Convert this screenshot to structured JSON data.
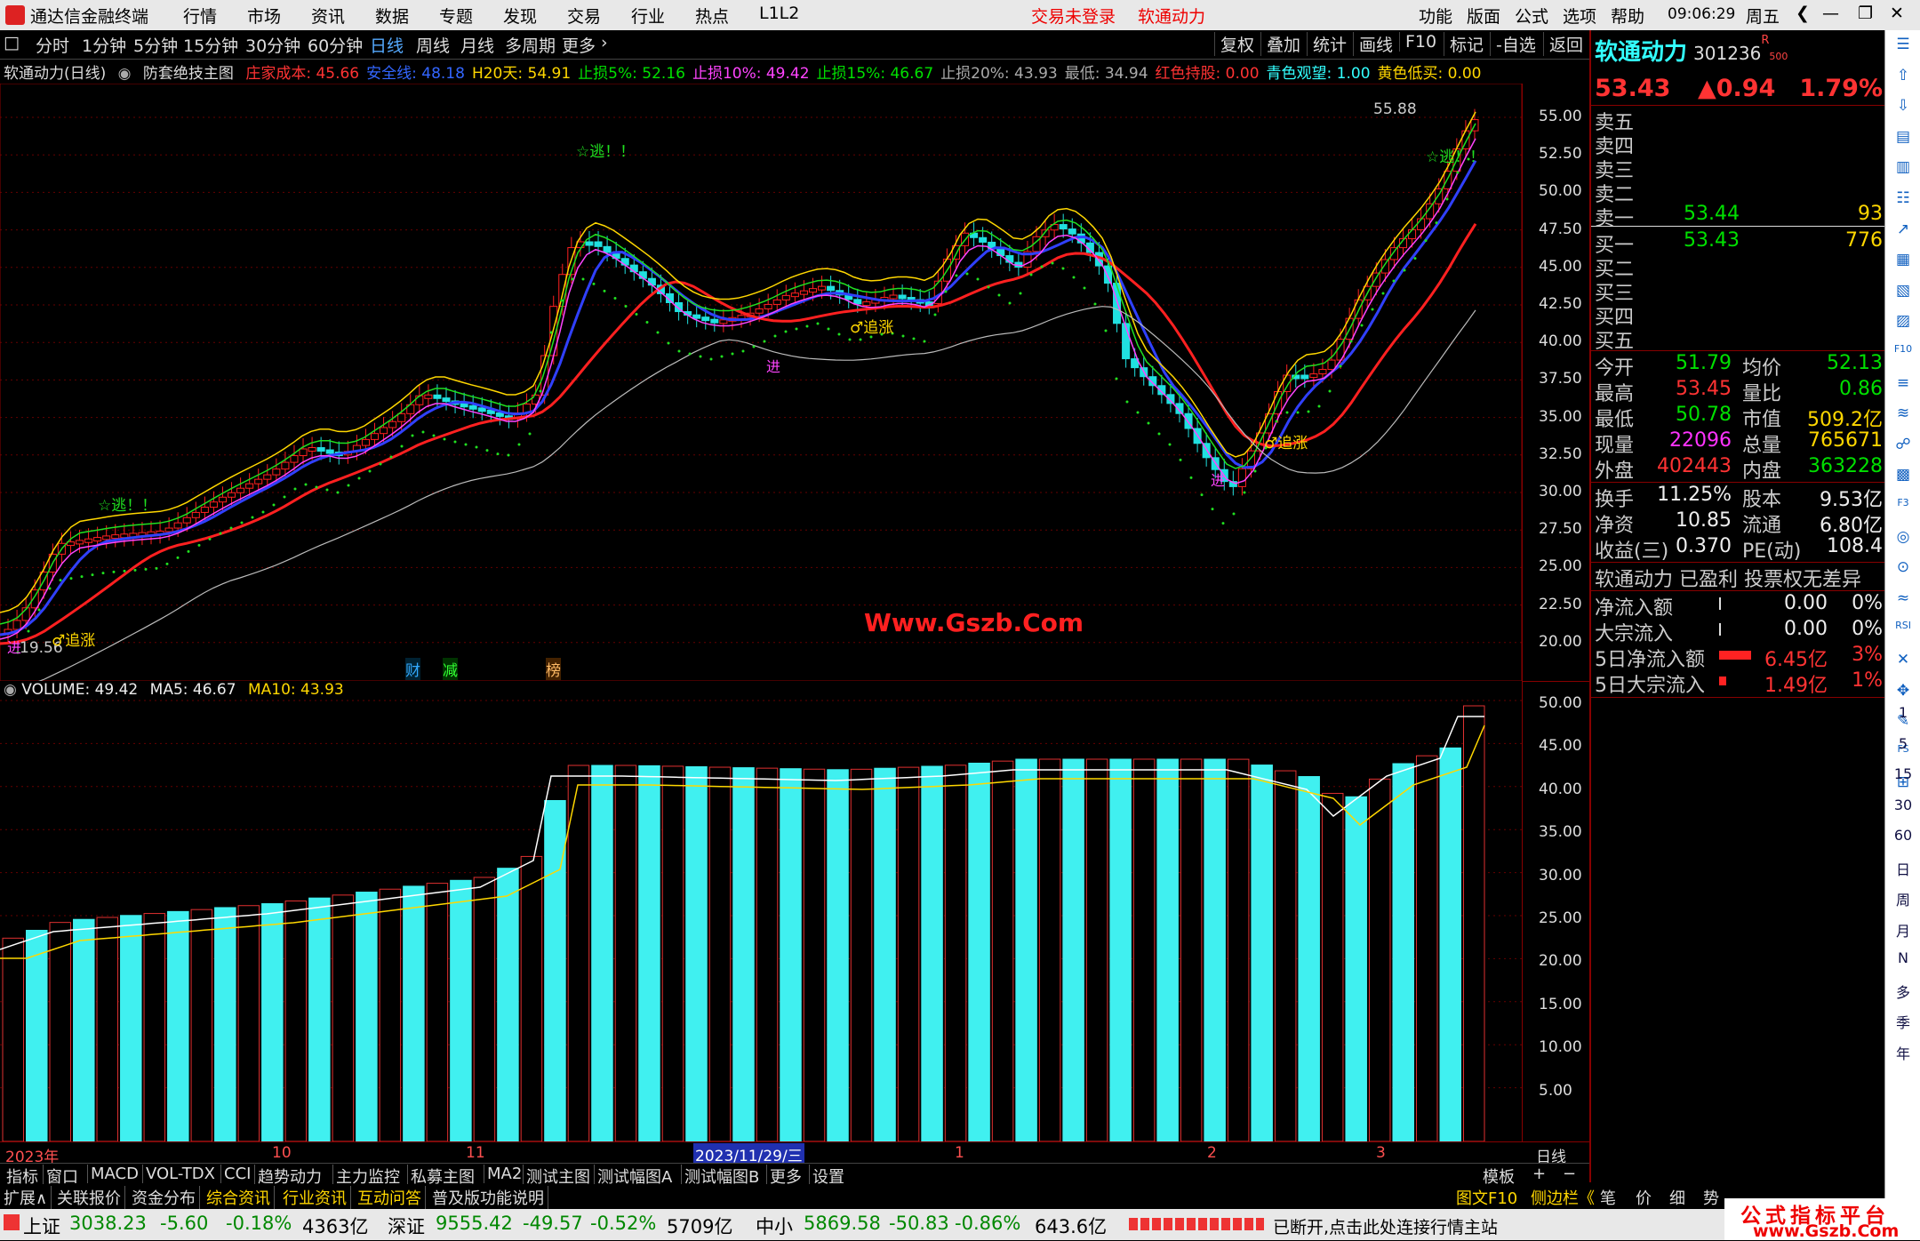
{
  "app": {
    "title": "通达信金融终端"
  },
  "menu": [
    "行情",
    "市场",
    "资讯",
    "数据",
    "专题",
    "发现",
    "交易",
    "行业",
    "热点",
    "L1L2"
  ],
  "login": {
    "status": "交易未登录",
    "stock": "软通动力"
  },
  "sys_menu": [
    "功能",
    "版面",
    "公式",
    "选项",
    "帮助"
  ],
  "clock": {
    "time": "09:06:29",
    "weekday": "周五"
  },
  "periods": [
    "分时",
    "1分钟",
    "5分钟",
    "15分钟",
    "30分钟",
    "60分钟",
    "日线",
    "周线",
    "月线",
    "多周期",
    "更多"
  ],
  "tools": [
    "复权",
    "叠加",
    "统计",
    "画线",
    "F10",
    "标记",
    "-自选",
    "返回"
  ],
  "info": {
    "name": "软通动力(日线)",
    "formula": "防套绝技主图",
    "items": [
      {
        "label": "庄家成本: 45.66",
        "color": "#ff3333"
      },
      {
        "label": "安全线: 48.18",
        "color": "#3366ff"
      },
      {
        "label": "H20天: 54.91",
        "color": "#ffd700"
      },
      {
        "label": "止损5%: 52.16",
        "color": "#00e000"
      },
      {
        "label": "止损10%: 49.42",
        "color": "#ff44ff"
      },
      {
        "label": "止损15%: 46.67",
        "color": "#00e000"
      },
      {
        "label": "止损20%: 43.93",
        "color": "#aaaaaa"
      },
      {
        "label": "最低: 34.94",
        "color": "#aaaaaa"
      },
      {
        "label": "红色持股: 0.00",
        "color": "#ff3333"
      },
      {
        "label": "青色观望: 1.00",
        "color": "#33ffff"
      },
      {
        "label": "黄色低买: 0.00",
        "color": "#ffd700"
      }
    ]
  },
  "price_axis": [
    "55.00",
    "52.50",
    "50.00",
    "47.50",
    "45.00",
    "42.50",
    "40.00",
    "37.50",
    "35.00",
    "32.50",
    "30.00",
    "27.50",
    "25.00",
    "22.50",
    "20.00"
  ],
  "price_annotations": {
    "high": "55.88",
    "low": "19.56",
    "escape": "☆逃！！",
    "chase": "♂追涨",
    "enter": "进",
    "watermark": "Www.Gszb.Com"
  },
  "event_tags": [
    "财",
    "减",
    "榜"
  ],
  "volume": {
    "label": "VOLUME: 49.42",
    "ma5": "MA5: 46.67",
    "ma10": "MA10: 43.93"
  },
  "vol_axis": [
    "50.00",
    "45.00",
    "40.00",
    "35.00",
    "30.00",
    "25.00",
    "20.00",
    "15.00",
    "10.00",
    "5.00"
  ],
  "date_axis": {
    "year": "2023年",
    "m10": "10",
    "m11": "11",
    "cursor": "2023/11/29/三",
    "m1": "1",
    "m2": "2",
    "m3": "3",
    "period": "日线"
  },
  "indicator_tabs": [
    "指标",
    "窗口",
    "MACD",
    "VOL-TDX",
    "CCI",
    "趋势动力",
    "主力监控",
    "私募主图",
    "MA2",
    "测试主图",
    "测试幅图A",
    "测试幅图B",
    "更多",
    "设置"
  ],
  "template": {
    "label": "模板",
    "plus": "+",
    "minus": "−"
  },
  "ext_tabs": [
    "扩展∧",
    "关联报价",
    "资金分布",
    "综合资讯",
    "行业资讯",
    "互动问答",
    "普及版功能说明"
  ],
  "side_tabs": [
    "图文F10",
    "侧边栏《",
    "笔",
    "价",
    "细",
    "势"
  ],
  "quote": {
    "name": "软通动力",
    "code": "301236",
    "badge": "R",
    "sub": "500",
    "price": "53.43",
    "change": "▲0.94",
    "pct": "1.79%",
    "asks": [
      {
        "l": "卖五",
        "p": "",
        "v": ""
      },
      {
        "l": "卖四",
        "p": "",
        "v": ""
      },
      {
        "l": "卖三",
        "p": "",
        "v": ""
      },
      {
        "l": "卖二",
        "p": "",
        "v": ""
      },
      {
        "l": "卖一",
        "p": "53.44",
        "v": "93"
      }
    ],
    "bids": [
      {
        "l": "买一",
        "p": "53.43",
        "v": "776"
      },
      {
        "l": "买二",
        "p": "",
        "v": ""
      },
      {
        "l": "买三",
        "p": "",
        "v": ""
      },
      {
        "l": "买四",
        "p": "",
        "v": ""
      },
      {
        "l": "买五",
        "p": "",
        "v": ""
      }
    ],
    "stats": [
      {
        "a": "今开",
        "av": "51.79",
        "b": "均价",
        "bv": "52.13"
      },
      {
        "a": "最高",
        "av": "53.45",
        "b": "量比",
        "bv": "0.86"
      },
      {
        "a": "最低",
        "av": "50.78",
        "b": "市值",
        "bv": "509.2亿"
      },
      {
        "a": "现量",
        "av": "22096",
        "b": "总量",
        "bv": "765671"
      },
      {
        "a": "外盘",
        "av": "402443",
        "b": "内盘",
        "bv": "363228"
      }
    ],
    "stats2": [
      {
        "a": "换手",
        "av": "11.25%",
        "b": "股本",
        "bv": "9.53亿"
      },
      {
        "a": "净资",
        "av": "10.85",
        "b": "流通",
        "bv": "6.80亿"
      },
      {
        "a": "收益(三)",
        "av": "0.370",
        "b": "PE(动)",
        "bv": "108.4"
      }
    ],
    "profile": "软通动力 已盈利 投票权无差异",
    "flows": [
      {
        "l": "净流入额",
        "v": "0.00",
        "p": "0%"
      },
      {
        "l": "大宗流入",
        "v": "0.00",
        "p": "0%"
      },
      {
        "l": "5日净流入额",
        "v": "6.45亿",
        "p": "3%"
      },
      {
        "l": "5日大宗流入",
        "v": "1.49亿",
        "p": "1%"
      }
    ]
  },
  "right_icons": [
    "1",
    "5",
    "15",
    "30",
    "60",
    "日",
    "周",
    "月",
    "N",
    "多",
    "季",
    "年"
  ],
  "status": {
    "sh": "上证",
    "sh_v": "3038.23",
    "sh_c": "-5.60",
    "sh_p": "-0.18%",
    "sh_a": "4363亿",
    "sz": "深证",
    "sz_v": "9555.42",
    "sz_c": "-49.57",
    "sz_p": "-0.52%",
    "sz_a": "5709亿",
    "zx": "中小",
    "zx_v": "5869.58",
    "zx_c": "-50.83",
    "zx_p": "-0.86%",
    "zx_a": "643.6亿",
    "conn": "已断开,点击此处连接行情主站",
    "brand": "公式指标平台",
    "brand_url": "www.Gszb.Com"
  }
}
